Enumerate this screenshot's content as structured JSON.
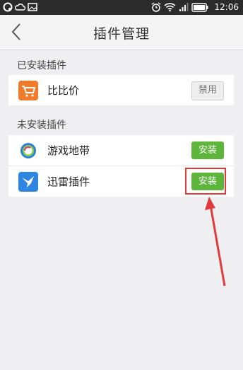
{
  "status_bar": {
    "time": "12:06",
    "left_icons": [
      "app-icon",
      "cloud-icon",
      "image-icon"
    ],
    "right_icons": [
      "alarm-icon",
      "wifi-icon",
      "signal-icon",
      "battery-icon"
    ]
  },
  "header": {
    "title": "插件管理",
    "back_icon": "chevron-left-icon"
  },
  "installed": {
    "label": "已安装插件",
    "items": [
      {
        "name": "比比价",
        "button": "禁用",
        "icon": "shopping-cart-icon",
        "color": "#f07b2b"
      }
    ]
  },
  "not_installed": {
    "label": "未安装插件",
    "items": [
      {
        "name": "游戏地带",
        "button": "安装",
        "icon": "game-zone-icon",
        "color": "#2f7fd6"
      },
      {
        "name": "迅雷插件",
        "button": "安装",
        "icon": "thunder-bird-icon",
        "color": "#2f86e0"
      }
    ]
  },
  "colors": {
    "install_button": "#5db53c",
    "highlight": "#e23a3a"
  }
}
